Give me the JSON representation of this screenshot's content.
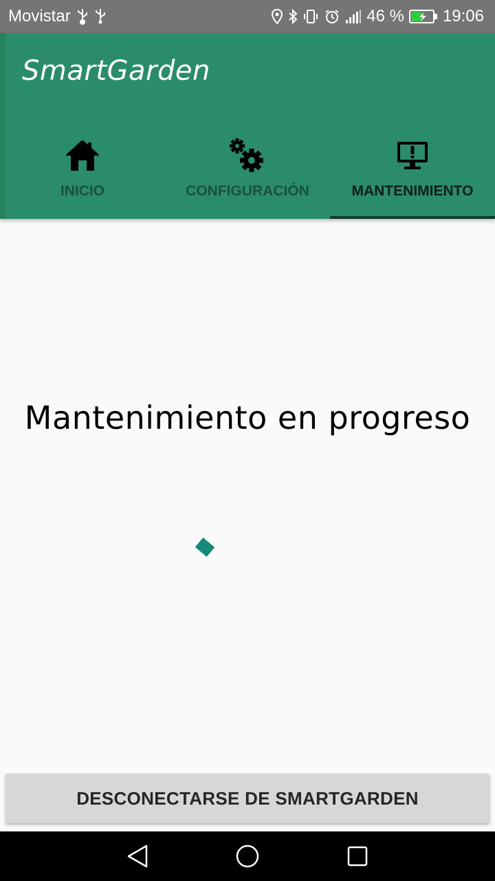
{
  "status_bar": {
    "carrier": "Movistar",
    "battery": "46 %",
    "time": "19:06",
    "icons_left": [
      "usb-icon",
      "usb-icon"
    ],
    "icons_right": [
      "location-icon",
      "bluetooth-icon",
      "vibrate-icon",
      "alarm-icon",
      "signal-icon",
      "battery-charging-icon"
    ]
  },
  "app_bar": {
    "title": "SmartGarden",
    "color": "#2a8c6a"
  },
  "tabs": [
    {
      "label": "INICIO",
      "icon": "home-icon",
      "active": false
    },
    {
      "label": "CONFIGURACIÓN",
      "icon": "gears-icon",
      "active": false
    },
    {
      "label": "MANTENIMIENTO",
      "icon": "monitor-alert-icon",
      "active": true
    }
  ],
  "main": {
    "message": "Mantenimiento en progreso",
    "spinner_color": "#14897a"
  },
  "disconnect_button": {
    "label": "DESCONECTARSE DE SMARTGARDEN"
  },
  "nav_bar": {
    "buttons": [
      "back-icon",
      "home-circle-icon",
      "recents-icon"
    ]
  }
}
